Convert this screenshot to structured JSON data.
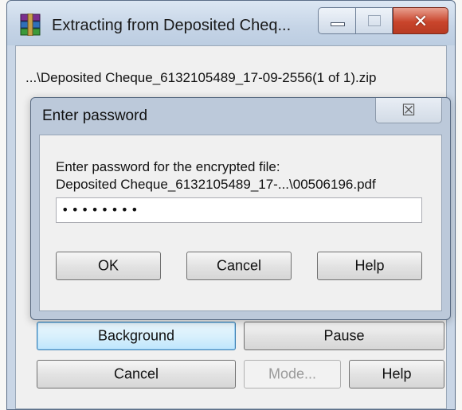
{
  "outer_window": {
    "title": "Extracting from Deposited Cheq...",
    "path": "...\\Deposited Cheque_6132105489_17-09-2556(1 of 1).zip",
    "buttons": {
      "background": "Background",
      "pause": "Pause",
      "cancel": "Cancel",
      "mode": "Mode...",
      "help": "Help"
    }
  },
  "password_dialog": {
    "title": "Enter password",
    "prompt_line1": "Enter password for the encrypted file:",
    "prompt_line2": "Deposited Cheque_6132105489_17-...\\00506196.pdf",
    "password_value": "••••••••",
    "buttons": {
      "ok": "OK",
      "cancel": "Cancel",
      "help": "Help"
    }
  },
  "icons": {
    "app": "winrar-archive-icon",
    "minimize": "minimize-icon",
    "maximize": "maximize-icon",
    "close": "close-icon",
    "dialog_close": "close-icon"
  },
  "colors": {
    "frame": "#c9d6e6",
    "close_button": "#c9452c",
    "focus_border": "#3c7fb1"
  }
}
